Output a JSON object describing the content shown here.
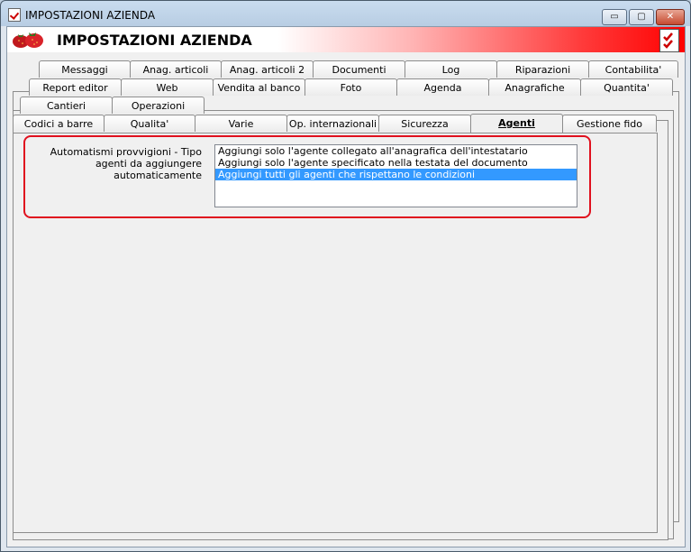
{
  "window": {
    "title": "IMPOSTAZIONI AZIENDA",
    "minimize_label": "▭",
    "maximize_label": "▢",
    "close_label": "✕"
  },
  "header": {
    "title": "IMPOSTAZIONI AZIENDA"
  },
  "tabs": {
    "row1": [
      "Messaggi",
      "Anag. articoli",
      "Anag. articoli 2",
      "Documenti",
      "Log",
      "Riparazioni",
      "Contabilita'"
    ],
    "row2": [
      "Report editor",
      "Web",
      "Vendita al banco",
      "Foto",
      "Agenda",
      "Anagrafiche",
      "Quantita'"
    ],
    "row3": [
      "Cantieri",
      "Operazioni"
    ],
    "row4": [
      "Codici a barre",
      "Qualita'",
      "Varie",
      "Op. internazionali",
      "Sicurezza",
      "Agenti",
      "Gestione fido"
    ],
    "active": "Agenti"
  },
  "agenti": {
    "label": "Automatismi provvigioni - Tipo agenti da aggiungere automaticamente",
    "options": [
      "Aggiungi solo l'agente collegato all'anagrafica dell'intestatario",
      "Aggiungi solo l'agente specificato nella testata del documento",
      "Aggiungi tutti gli agenti che rispettano le condizioni"
    ],
    "selected_index": 2
  },
  "colors": {
    "highlight_border": "#e0101e",
    "selection": "#3399ff",
    "header_red": "#ff0000"
  }
}
